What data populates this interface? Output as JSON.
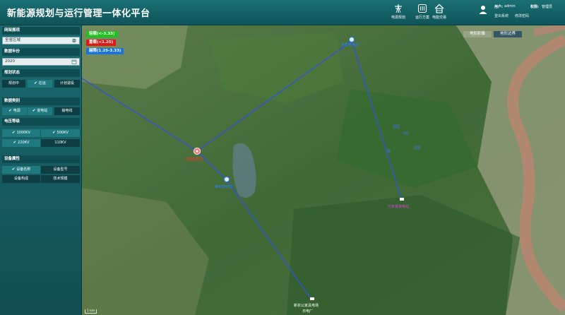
{
  "header": {
    "title": "新能源规划与运行管理一体化平台",
    "nav": [
      {
        "label": "电源规划",
        "icon": "power-tower-icon"
      },
      {
        "label": "运行方案",
        "icon": "list-icon"
      },
      {
        "label": "电能交易",
        "icon": "home-icon"
      }
    ],
    "user": {
      "user_label": "用户:",
      "user_value": "admin",
      "role_label": "权限:",
      "role_value": "管理员",
      "logout": "登出系统",
      "change_password": "修改密码"
    }
  },
  "sidebar": {
    "region": {
      "title": "网架展现",
      "value": "全省区域"
    },
    "year": {
      "title": "数据年份",
      "value": "2020"
    },
    "plan_status": {
      "title": "规划状态",
      "buttons": [
        {
          "label": "规划中",
          "checked": false
        },
        {
          "label": "在运",
          "checked": true
        },
        {
          "label": "计划退役",
          "checked": false
        }
      ]
    },
    "data_category": {
      "title": "数据类别",
      "buttons": [
        {
          "label": "电源",
          "checked": true
        },
        {
          "label": "变电站",
          "checked": true
        },
        {
          "label": "输电线",
          "checked": false
        }
      ]
    },
    "voltage": {
      "title": "电压等级",
      "buttons": [
        {
          "label": "1000KV",
          "checked": true
        },
        {
          "label": "500KV",
          "checked": true
        },
        {
          "label": "220KV",
          "checked": true
        },
        {
          "label": "110KV",
          "checked": false
        }
      ]
    },
    "device_attr": {
      "title": "设备属性",
      "buttons": [
        {
          "label": "设备名称",
          "checked": true
        },
        {
          "label": "设备型号",
          "checked": false
        },
        {
          "label": "设备构成",
          "checked": false
        },
        {
          "label": "技术规模",
          "checked": false
        }
      ]
    }
  },
  "map": {
    "legend": [
      {
        "label": "轻载(<-3.33)",
        "color": "#1fc21f"
      },
      {
        "label": "重载(<1.25)",
        "color": "#e01818"
      },
      {
        "label": "越限(1.25-3.33)",
        "color": "#1a74e0"
      }
    ],
    "tabs": [
      "地形影像",
      "地形边界"
    ],
    "scale": "1 km",
    "stations": [
      {
        "name": "凉坡变电站",
        "color": "#ff3030"
      },
      {
        "name": "吉安变电站",
        "color": "#2a80ff"
      },
      {
        "name": "泰和变电站",
        "color": "#2a80ff"
      },
      {
        "name": "万安县变电站",
        "color": "#e040e0"
      },
      {
        "name": "新农公家具电场",
        "color": "#ffffff"
      },
      {
        "name": "日电厂",
        "color": "#ffffff"
      }
    ]
  }
}
